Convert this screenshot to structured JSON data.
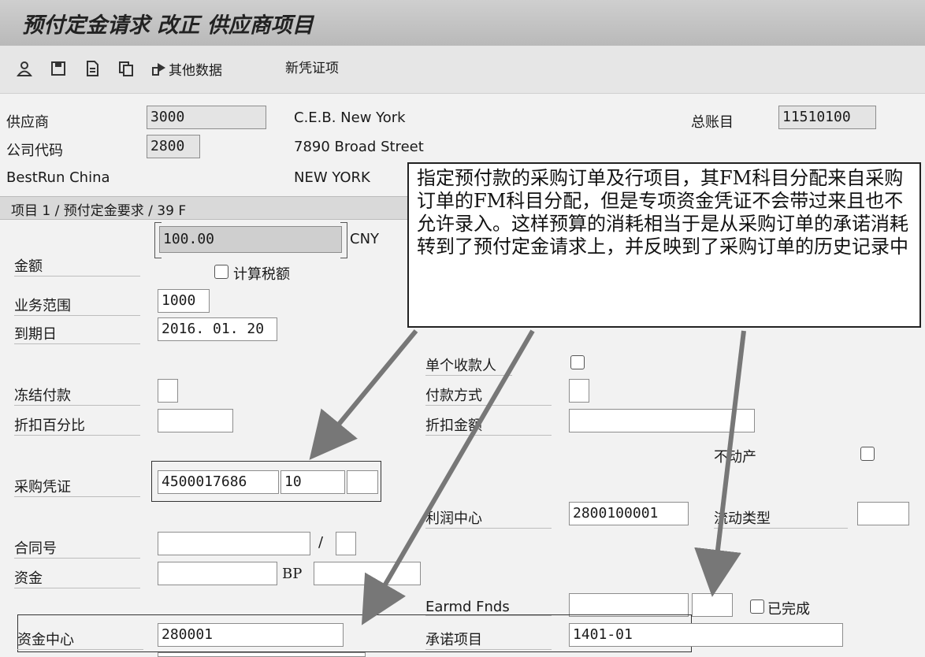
{
  "window": {
    "title": "预付定金请求 改正 供应商项目"
  },
  "toolbar": {
    "other_data_label": "其他数据",
    "new_item_label": "新凭证项",
    "icons": [
      "person-icon",
      "save-icon",
      "document-icon",
      "copy-icon",
      "arrow-right-icon"
    ]
  },
  "header": {
    "vendor_label": "供应商",
    "vendor_value": "3000",
    "vendor_name": "C.E.B. New York",
    "company_code_label": "公司代码",
    "company_code_value": "2800",
    "street": "7890 Broad Street",
    "company_name": "BestRun China",
    "city": "NEW YORK",
    "gl_account_label": "总账目",
    "gl_account_value": "11510100"
  },
  "section": {
    "title": "项目 1 / 预付定金要求 / 39 F"
  },
  "form": {
    "amount_label": "金额",
    "amount_value": "100.00",
    "currency": "CNY",
    "calc_tax_label": "计算税额",
    "business_area_label": "业务范围",
    "business_area_value": "1000",
    "due_date_label": "到期日",
    "due_date_value": "2016. 01. 20",
    "single_payee_label": "单个收款人",
    "payment_block_label": "冻结付款",
    "payment_method_label": "付款方式",
    "discount_percent_label": "折扣百分比",
    "discount_amount_label": "折扣金额",
    "real_estate_label": "不动产",
    "purchase_doc_label": "采购凭证",
    "purchase_doc_value": "4500017686",
    "purchase_item_value": "10",
    "profit_center_label": "利润中心",
    "profit_center_value": "2800100001",
    "flow_type_label": "流动类型",
    "contract_label": "合同号",
    "contract_sep": "/",
    "fund_label": "资金",
    "bp_label": "BP",
    "earmarked_funds_label": "Earmd Fnds",
    "completed_label": "已完成",
    "funds_center_label": "资金中心",
    "funds_center_value": "280001",
    "commitment_item_label": "承诺项目",
    "commitment_item_value": "1401-01"
  },
  "annotation": {
    "text": "指定预付款的采购订单及行项目，其FM科目分配来自采购订单的FM科目分配，但是专项资金凭证不会带过来且也不允许录入。这样预算的消耗相当于是从采购订单的承诺消耗转到了预付定金请求上，并反映到了采购订单的历史记录中"
  }
}
